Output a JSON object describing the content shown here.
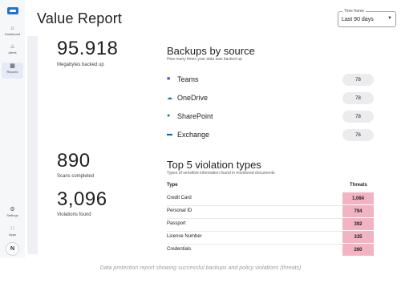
{
  "sidebar": {
    "items": [
      {
        "label": "Dashboard",
        "icon": "home-icon"
      },
      {
        "label": "Alerts",
        "icon": "bell-icon"
      },
      {
        "label": "Reports",
        "icon": "chart-icon"
      },
      {
        "label": "Settings",
        "icon": "gear-icon"
      },
      {
        "label": "Apps",
        "icon": "grid-icon"
      }
    ],
    "avatar": "N"
  },
  "header": {
    "title": "Value Report",
    "time_frame": {
      "label": "Time frame",
      "value": "Last 90 days"
    }
  },
  "stats": {
    "backed_up": {
      "value": "95.918",
      "label": "Megabytes backed up"
    },
    "scans": {
      "value": "890",
      "label": "Scans completed"
    },
    "violations": {
      "value": "3,096",
      "label": "Violations found"
    }
  },
  "backups": {
    "title": "Backups by source",
    "subtitle": "How many times your data was backed up",
    "sources": [
      {
        "name": "Teams",
        "count": "78",
        "icon": "teams-icon"
      },
      {
        "name": "OneDrive",
        "count": "78",
        "icon": "onedrive-icon"
      },
      {
        "name": "SharePoint",
        "count": "78",
        "icon": "sharepoint-icon"
      },
      {
        "name": "Exchange",
        "count": "76",
        "icon": "exchange-icon"
      }
    ]
  },
  "violations": {
    "title": "Top 5 violation types",
    "subtitle": "Types of sensitive information found in monitored documents",
    "col_type": "Type",
    "col_threats": "Threats",
    "rows": [
      {
        "type": "Credit Card",
        "threats": "1,084"
      },
      {
        "type": "Personal ID",
        "threats": "794"
      },
      {
        "type": "Passport",
        "threats": "392"
      },
      {
        "type": "License Number",
        "threats": "335"
      },
      {
        "type": "Credentials",
        "threats": "260"
      }
    ]
  },
  "caption": "Data protection report showing successful backups and policy violations (threats)",
  "colors": {
    "accent": "#1e73d8",
    "threat": "#f2b3c3",
    "pill": "#ececee"
  }
}
